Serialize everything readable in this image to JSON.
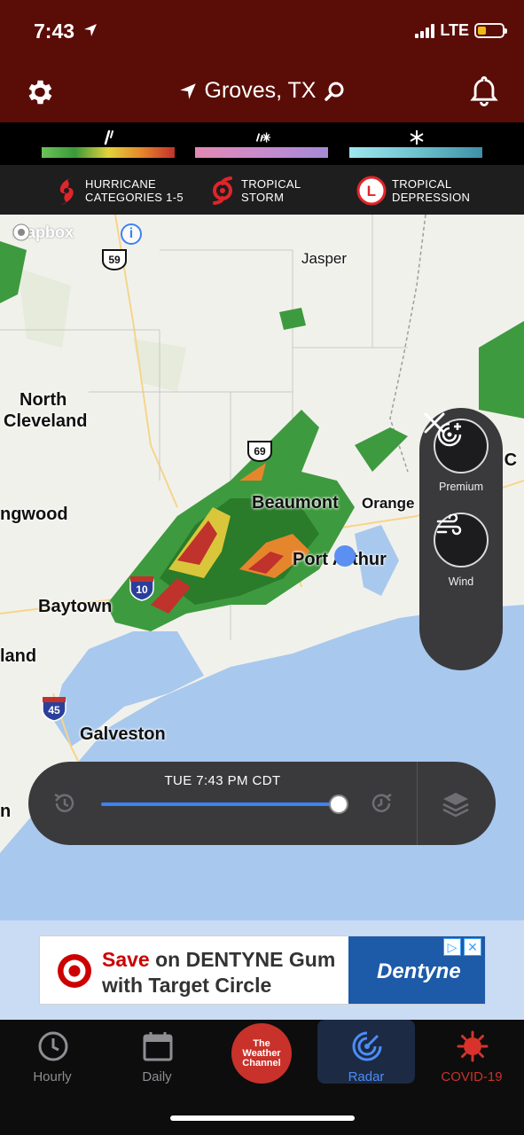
{
  "status_bar": {
    "time": "7:43",
    "network": "LTE"
  },
  "header": {
    "location": "Groves, TX"
  },
  "legend": {
    "storms": [
      {
        "line1": "HURRICANE",
        "line2": "CATEGORIES 1-5"
      },
      {
        "line1": "TROPICAL",
        "line2": "STORM"
      },
      {
        "line1": "TROPICAL",
        "line2": "DEPRESSION"
      }
    ],
    "depression_letter": "L"
  },
  "map": {
    "attribution": "mapbox",
    "info_glyph": "i",
    "cities": {
      "jasper": "Jasper",
      "north_cleveland_1": "North",
      "north_cleveland_2": "Cleveland",
      "beaumont": "Beaumont",
      "orange": "Orange",
      "port_arthur": "Port Arthur",
      "baytown": "Baytown",
      "galveston": "Galveston",
      "kingwood": "ngwood",
      "highland": "land",
      "left_n": "n",
      "right_c": "e C"
    },
    "shields": {
      "us59": "59",
      "us69": "69",
      "i10": "10",
      "i45": "45"
    }
  },
  "side_panel": {
    "premium_label": "Premium",
    "wind_label": "Wind"
  },
  "timeline": {
    "time_label": "TUE 7:43 PM CDT",
    "progress": 1.0
  },
  "ad": {
    "save_word": "Save",
    "line1_rest": " on DENTYNE Gum",
    "line2": "with Target Circle",
    "brand": "Dentyne"
  },
  "tabs": {
    "hourly": "Hourly",
    "daily": "Daily",
    "logo_line1": "The",
    "logo_line2": "Weather",
    "logo_line3": "Channel",
    "radar": "Radar",
    "covid": "COVID-19"
  },
  "colors": {
    "header_bg": "#5a0d06",
    "accent_blue": "#3b82f6",
    "twc_red": "#c8322b",
    "water": "#a8c8ee"
  }
}
